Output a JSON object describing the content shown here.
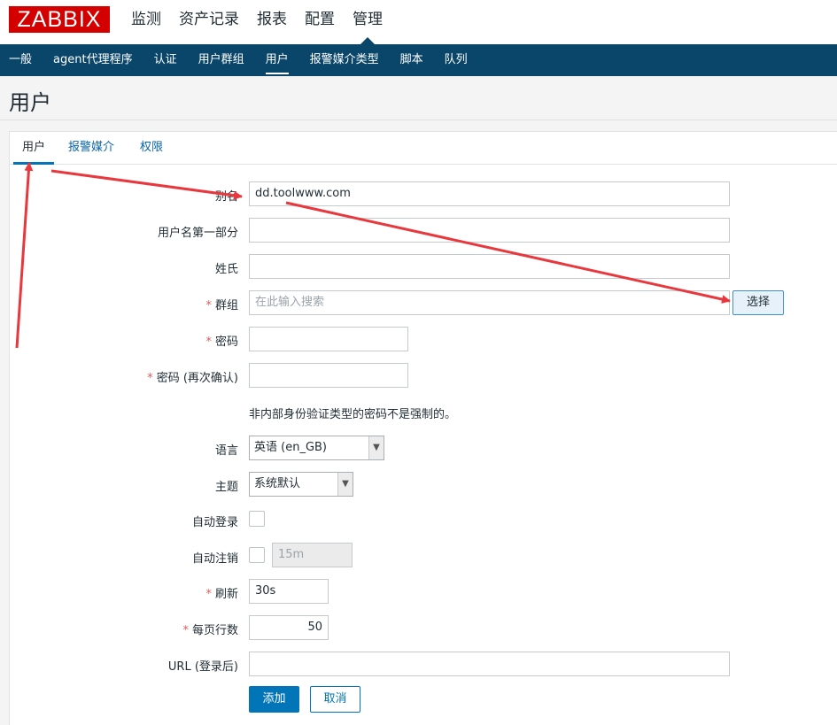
{
  "header": {
    "logo": "ZABBIX",
    "menu": [
      "监测",
      "资产记录",
      "报表",
      "配置",
      "管理"
    ],
    "active_menu": "管理"
  },
  "subnav": {
    "items": [
      "一般",
      "agent代理程序",
      "认证",
      "用户群组",
      "用户",
      "报警媒介类型",
      "脚本",
      "队列"
    ],
    "active": "用户"
  },
  "page": {
    "title": "用户"
  },
  "tabs": [
    "用户",
    "报警媒介",
    "权限"
  ],
  "form": {
    "alias": {
      "label": "别名",
      "value": "dd.toolwww.com"
    },
    "name": {
      "label": "用户名第一部分",
      "value": ""
    },
    "surname": {
      "label": "姓氏",
      "value": ""
    },
    "groups": {
      "label": "群组",
      "placeholder": "在此输入搜索",
      "button": "选择",
      "required": true
    },
    "password": {
      "label": "密码",
      "value": "",
      "required": true
    },
    "password_confirm": {
      "label": "密码 (再次确认)",
      "value": "",
      "required": true
    },
    "password_note": "非内部身份验证类型的密码不是强制的。",
    "language": {
      "label": "语言",
      "value": "英语 (en_GB)"
    },
    "theme": {
      "label": "主题",
      "value": "系统默认"
    },
    "autologin": {
      "label": "自动登录",
      "checked": false
    },
    "autologout": {
      "label": "自动注销",
      "checked": false,
      "value": "15m"
    },
    "refresh": {
      "label": "刷新",
      "value": "30s",
      "required": true
    },
    "rows_per_page": {
      "label": "每页行数",
      "value": "50",
      "required": true
    },
    "url": {
      "label": "URL (登录后)",
      "value": ""
    },
    "buttons": {
      "add": "添加",
      "cancel": "取消"
    }
  },
  "colors": {
    "brand_red": "#d40000",
    "nav_bg": "#0a466a",
    "primary": "#0275b8",
    "required": "#e45959",
    "annotation_arrow": "#e8383d"
  }
}
